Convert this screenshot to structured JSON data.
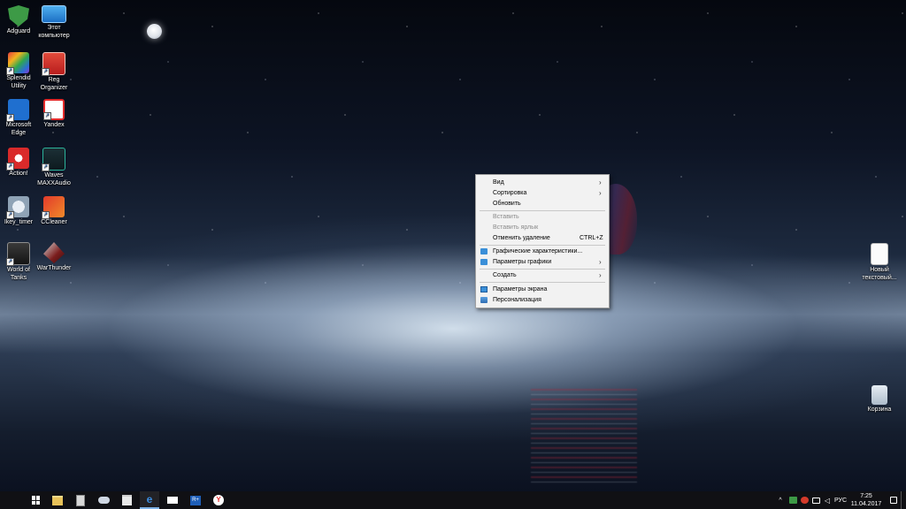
{
  "desktop": {
    "icons_left": [
      {
        "label": "Adguard",
        "icon": "adguard-icon"
      },
      {
        "label": "Этот компьютер",
        "icon": "computer-icon"
      },
      {
        "label": "Splendid Utility",
        "icon": "splendid-icon"
      },
      {
        "label": "Reg Organizer",
        "icon": "reg-organizer-icon"
      },
      {
        "label": "Microsoft Edge",
        "icon": "edge-icon"
      },
      {
        "label": "Yandex",
        "icon": "yandex-icon"
      },
      {
        "label": "Action!",
        "icon": "action-icon"
      },
      {
        "label": "Waves MAXXAudio",
        "icon": "waves-icon"
      },
      {
        "label": "Ikey_timer",
        "icon": "ikey-timer-icon"
      },
      {
        "label": "CCleaner",
        "icon": "ccleaner-icon"
      },
      {
        "label": "World of Tanks",
        "icon": "world-of-tanks-icon"
      },
      {
        "label": "WarThunder",
        "icon": "warthunder-icon"
      }
    ],
    "icons_right": [
      {
        "label": "Новый текстовый...",
        "icon": "text-document-icon"
      },
      {
        "label": "Корзина",
        "icon": "recycle-bin-icon"
      }
    ]
  },
  "context_menu": {
    "items": [
      {
        "label": "Вид",
        "submenu": true
      },
      {
        "label": "Сортировка",
        "submenu": true
      },
      {
        "label": "Обновить"
      },
      {
        "label": "Вставить",
        "disabled": true
      },
      {
        "label": "Вставить ярлык",
        "disabled": true
      },
      {
        "label": "Отменить удаление",
        "shortcut": "CTRL+Z"
      },
      {
        "label": "Графические характеристики...",
        "icon": "intel-graphics-icon"
      },
      {
        "label": "Параметры графики",
        "icon": "intel-graphics-icon",
        "submenu": true
      },
      {
        "label": "Создать",
        "submenu": true
      },
      {
        "label": "Параметры экрана",
        "icon": "display-settings-icon"
      },
      {
        "label": "Персонализация",
        "icon": "personalization-icon"
      }
    ],
    "submenu_arrow": "›"
  },
  "taskbar": {
    "pinned": [
      "start-icon",
      "file-explorer-icon",
      "calculator-icon",
      "cloud-app-icon",
      "store-icon",
      "edge-icon",
      "mail-icon",
      "r-plus-icon",
      "yandex-browser-icon"
    ],
    "active": "edge-icon",
    "edge_glyph": "e",
    "rplus_glyph": "R+",
    "yandex_glyph": "Y",
    "tray": {
      "chevron": "^",
      "language": "РУС",
      "time": "7:25",
      "date": "11.04.2017"
    }
  },
  "colors": {
    "menu_background": "#f2f2f2",
    "disabled_text": "#8a8a8a",
    "taskbar": "#101014",
    "accent": "#3a8fd8"
  }
}
